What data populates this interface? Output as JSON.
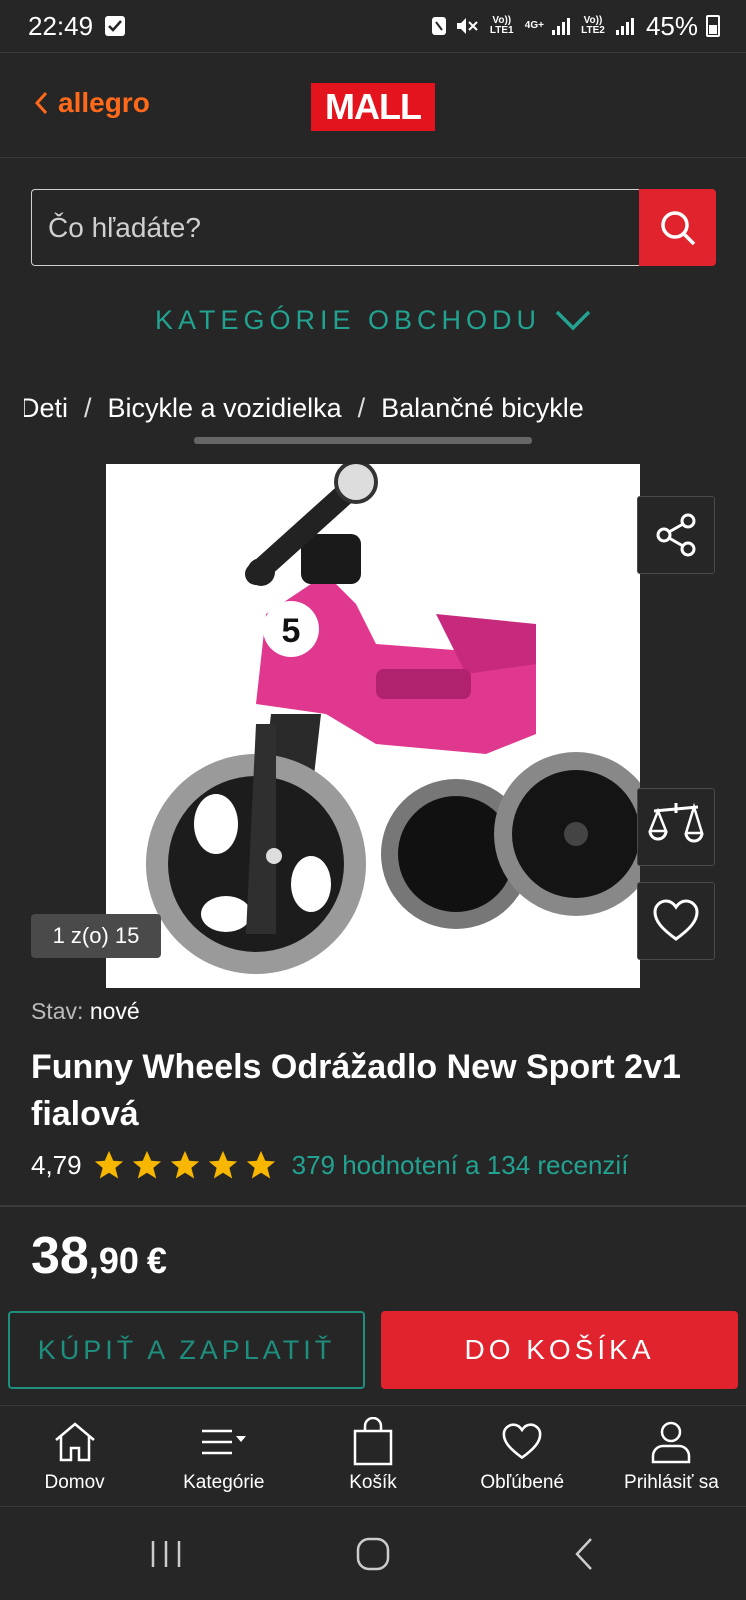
{
  "status_bar": {
    "time": "22:49",
    "sim1_label": "Vo)) LTE1",
    "network_label": "4G+",
    "sim2_label": "Vo)) LTE2",
    "battery": "45%"
  },
  "header": {
    "back_label": "allegro",
    "logo_text": "MALL",
    "accent_color": "#ff6a1a",
    "brand_color": "#e4141e"
  },
  "search": {
    "placeholder": "Čo hľadáte?",
    "value": ""
  },
  "categories": {
    "label": "KATEGÓRIE OBCHODU"
  },
  "breadcrumb": {
    "items": [
      "Deti",
      "Bicykle a vozidielka",
      "Balančné bicykle"
    ],
    "separator": "/"
  },
  "gallery": {
    "counter": "1 z(o) 15",
    "image_number": "5"
  },
  "product": {
    "condition_label": "Stav:",
    "condition_value": "nové",
    "title": "Funny Wheels Odrážadlo New Sport 2v1 fialová",
    "rating_value": "4,79",
    "stars": 5,
    "reviews_text": "379 hodnotení a 134 recenzií",
    "price_whole": "38",
    "price_cents": ",90",
    "currency": "€"
  },
  "actions": {
    "buy_label": "KÚPIŤ A ZAPLATIŤ",
    "cart_label": "DO KOŠÍKA"
  },
  "bottom_nav": {
    "items": [
      {
        "label": "Domov",
        "icon": "home-icon"
      },
      {
        "label": "Kategórie",
        "icon": "menu-icon"
      },
      {
        "label": "Košík",
        "icon": "bag-icon"
      },
      {
        "label": "Obľúbené",
        "icon": "heart-icon"
      },
      {
        "label": "Prihlásiť sa",
        "icon": "user-icon"
      }
    ]
  },
  "colors": {
    "teal": "#22a391",
    "red": "#e0232c",
    "background": "#262626"
  }
}
